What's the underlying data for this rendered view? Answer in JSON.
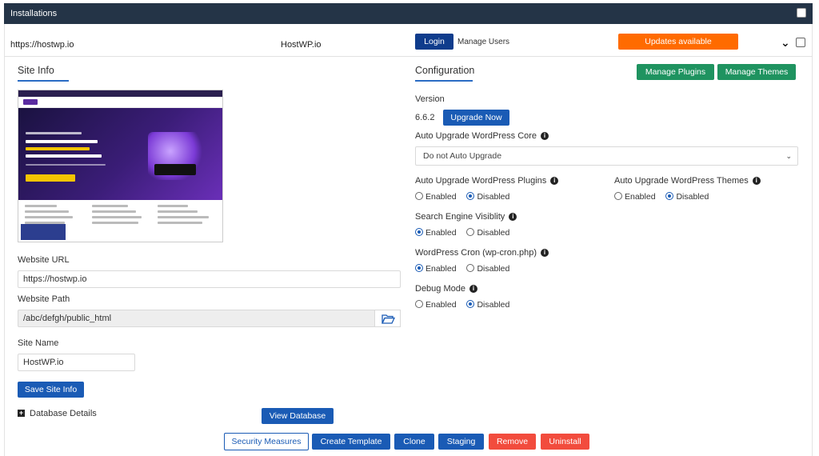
{
  "header": {
    "title": "Installations"
  },
  "install": {
    "url": "https://hostwp.io",
    "site_name": "HostWP.io",
    "login_label": "Login",
    "manage_users_label": "Manage Users",
    "updates_label": "Updates available"
  },
  "site_info": {
    "title": "Site Info",
    "website_url_label": "Website URL",
    "website_url_value": "https://hostwp.io",
    "website_path_label": "Website Path",
    "website_path_value": "/abc/defgh/public_html",
    "site_name_label": "Site Name",
    "site_name_value": "HostWP.io",
    "save_label": "Save Site Info",
    "database_details_label": "Database Details",
    "view_database_label": "View Database"
  },
  "configuration": {
    "title": "Configuration",
    "manage_plugins_label": "Manage Plugins",
    "manage_themes_label": "Manage Themes",
    "version_label": "Version",
    "version_value": "6.6.2",
    "upgrade_now_label": "Upgrade Now",
    "auto_core_label": "Auto Upgrade WordPress Core",
    "auto_core_value": "Do not Auto Upgrade",
    "auto_plugins_label": "Auto Upgrade WordPress Plugins",
    "auto_themes_label": "Auto Upgrade WordPress Themes",
    "search_engine_label": "Search Engine Visiblity",
    "cron_label": "WordPress Cron (wp-cron.php)",
    "debug_label": "Debug Mode",
    "enabled": "Enabled",
    "disabled": "Disabled",
    "info_glyph": "i"
  },
  "actions": {
    "security": "Security Measures",
    "template": "Create Template",
    "clone": "Clone",
    "staging": "Staging",
    "remove": "Remove",
    "uninstall": "Uninstall"
  },
  "colors": {
    "titlebar": "#243447",
    "primary_blue": "#1a5bb5",
    "green": "#1f9360",
    "orange": "#ff6b00",
    "red": "#f24c3d"
  }
}
